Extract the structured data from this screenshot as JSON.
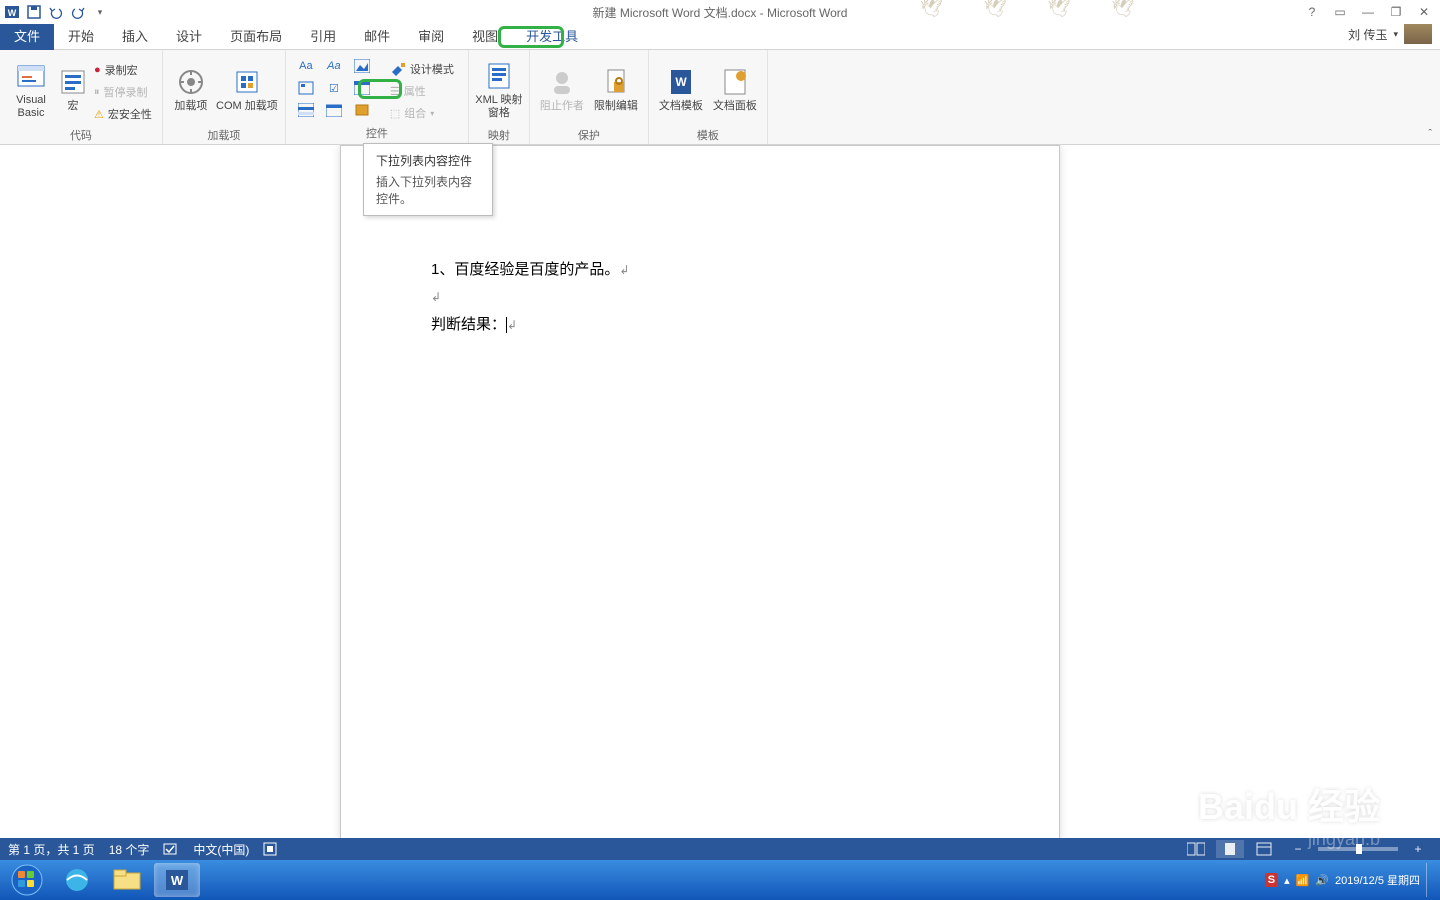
{
  "title": "新建 Microsoft Word 文档.docx - Microsoft Word",
  "user": {
    "name": "刘 传玉"
  },
  "qat": {
    "customize_tip": "▾"
  },
  "tabs": {
    "file": "文件",
    "items": [
      "开始",
      "插入",
      "设计",
      "页面布局",
      "引用",
      "邮件",
      "审阅",
      "视图",
      "开发工具"
    ]
  },
  "ribbon": {
    "code": {
      "label": "代码",
      "vb": "Visual Basic",
      "macro": "宏",
      "record": "录制宏",
      "pause": "暂停录制",
      "security": "宏安全性"
    },
    "addins": {
      "label": "加载项",
      "btn1": "加载项",
      "btn2": "COM 加载项"
    },
    "controls": {
      "label": "控件",
      "design": "设计模式",
      "props": "属性",
      "group": "组合"
    },
    "mapping": {
      "label": "映射",
      "btn": "XML 映射窗格"
    },
    "protect": {
      "label": "保护",
      "block": "阻止作者",
      "restrict": "限制编辑"
    },
    "templates": {
      "label": "模板",
      "tmpl": "文档模板",
      "panel": "文档面板"
    }
  },
  "tooltip": {
    "title": "下拉列表内容控件",
    "desc": "插入下拉列表内容控件。"
  },
  "document": {
    "line1": "1、百度经验是百度的产品。",
    "line3": "判断结果："
  },
  "statusbar": {
    "page": "第 1 页，共 1 页",
    "words": "18 个字",
    "lang": "中文(中国)"
  },
  "taskbar": {
    "datetime": "2019/12/5 星期四"
  },
  "watermark": {
    "main": "Baidu 经验",
    "sub": "jingyan.b"
  }
}
